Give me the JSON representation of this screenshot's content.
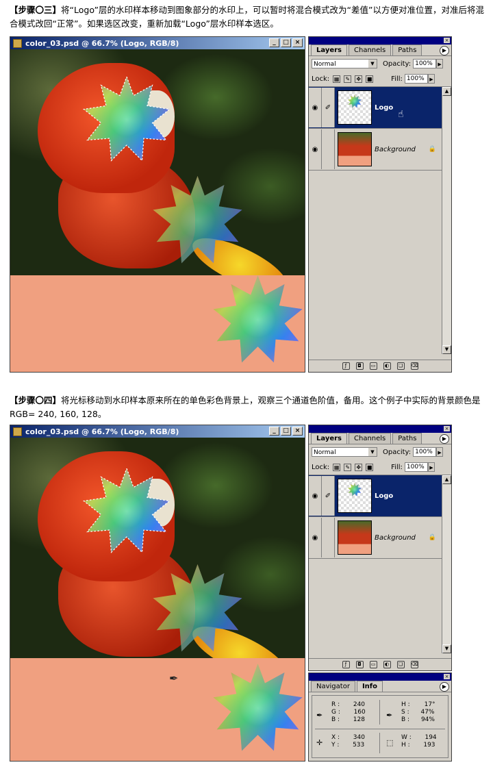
{
  "step3": {
    "heading": "【步骤〇三】",
    "text": "将“Logo”层的水印样本移动到图象部分的水印上，可以暂时将混合模式改为“差值”以方便对准位置，对准后将混合模式改回“正常”。如果选区改变，重新加载“Logo”层水印样本选区。"
  },
  "step4": {
    "heading": "【步骤〇四】",
    "text": "将光标移动到水印样本原来所在的单色彩色背景上，观察三个通道色阶值，备用。这个例子中实际的背景颜色是 RGB= 240, 160, 128。"
  },
  "document": {
    "title": "color_03.psd @ 66.7% (Logo, RGB/8)",
    "btn_min": "_",
    "btn_max": "□",
    "btn_close": "×"
  },
  "layers_panel": {
    "tabs": [
      "Layers",
      "Channels",
      "Paths"
    ],
    "blend_mode": "Normal",
    "opacity_label": "Opacity:",
    "opacity_value": "100%",
    "lock_label": "Lock:",
    "fill_label": "Fill:",
    "fill_value": "100%",
    "layers": [
      {
        "name": "Logo"
      },
      {
        "name": "Background"
      }
    ]
  },
  "info_panel": {
    "tabs": [
      "Navigator",
      "Info"
    ],
    "r_label": "R :",
    "r_value": "240",
    "g_label": "G :",
    "g_value": "160",
    "b_label": "B :",
    "b_value": "128",
    "h_label": "H :",
    "h_value": "17°",
    "s_label": "S :",
    "s_value": "47%",
    "bb_label": "B :",
    "bb_value": "94%",
    "x_label": "X :",
    "x_value": "340",
    "y_label": "Y :",
    "y_value": "533",
    "w_label": "W :",
    "w_value": "194",
    "hh_label": "H :",
    "hh_value": "193"
  },
  "colors": {
    "background_color": "#f0a080",
    "selection": "#0a246a"
  }
}
